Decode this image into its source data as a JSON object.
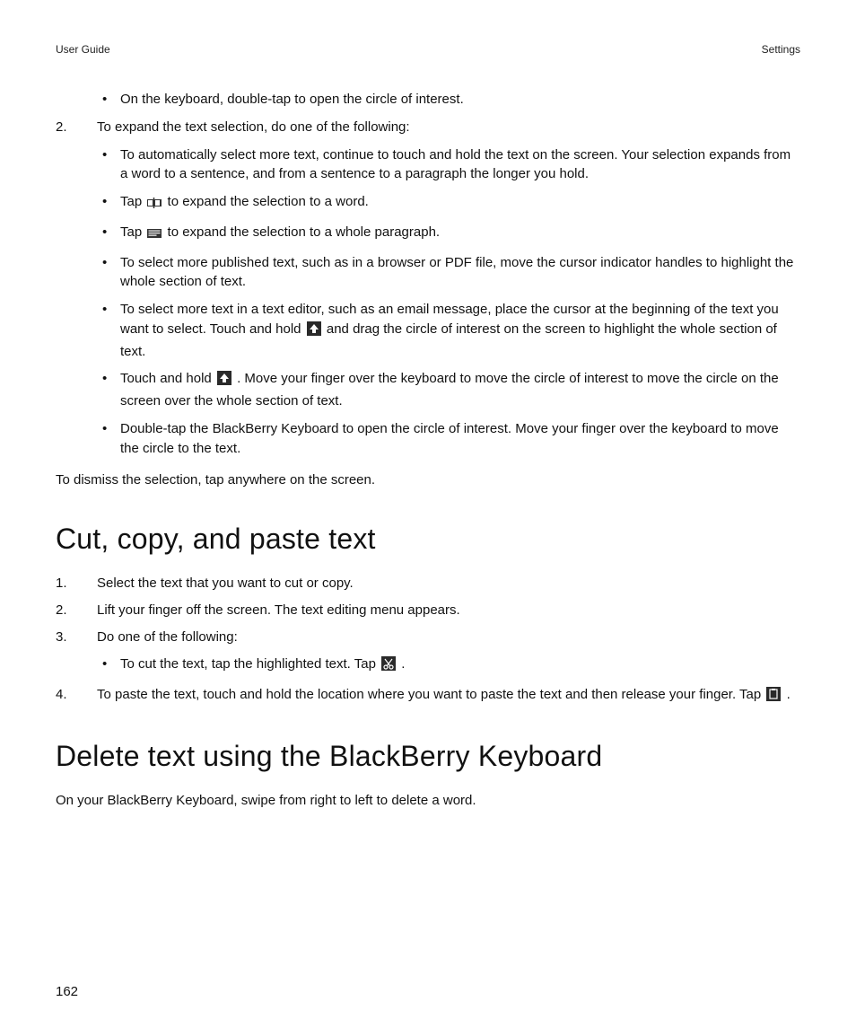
{
  "header": {
    "left": "User Guide",
    "right": "Settings"
  },
  "pageNumber": "162",
  "section1": {
    "prebullet": "On the keyboard, double-tap to open the circle of interest.",
    "step2": {
      "num": "2.",
      "lead": "To expand the text selection, do one of the following:"
    },
    "bullets": {
      "b1": "To automatically select more text, continue to touch and hold the text on the screen. Your selection expands from a word to a sentence, and from a sentence to a paragraph the longer you hold.",
      "b2_a": "Tap ",
      "b2_b": " to expand the selection to a word.",
      "b3_a": "Tap ",
      "b3_b": " to expand the selection to a whole paragraph.",
      "b4": "To select more published text, such as in a browser or PDF file, move the cursor indicator handles to highlight the whole section of text.",
      "b5_a": "To select more text in a text editor, such as an email message, place the cursor at the beginning of the text you want to select. Touch and hold ",
      "b5_b": " and drag the circle of interest on the screen to highlight the whole section of text.",
      "b6_a": "Touch and hold ",
      "b6_b": ". Move your finger over the keyboard to move the circle of interest to move the circle on the screen over the whole section of text.",
      "b7": "Double-tap the BlackBerry Keyboard to open the circle of interest. Move your finger over the keyboard to move the circle to the text."
    },
    "dismiss": "To dismiss the selection, tap anywhere on the screen."
  },
  "section2": {
    "heading": "Cut, copy, and paste text",
    "steps": {
      "s1": {
        "num": "1.",
        "text": "Select the text that you want to cut or copy."
      },
      "s2": {
        "num": "2.",
        "text": "Lift your finger off the screen. The text editing menu appears."
      },
      "s3": {
        "num": "3.",
        "text": "Do one of the following:"
      },
      "s3b_a": "To cut the text, tap the highlighted text. Tap ",
      "s3b_b": ".",
      "s4": {
        "num": "4.",
        "text_a": "To paste the text, touch and hold the location where you want to paste the text and then release your finger. Tap ",
        "text_b": "."
      }
    }
  },
  "section3": {
    "heading": "Delete text using the BlackBerry Keyboard",
    "body": "On your BlackBerry Keyboard, swipe from right to left to delete a word."
  }
}
